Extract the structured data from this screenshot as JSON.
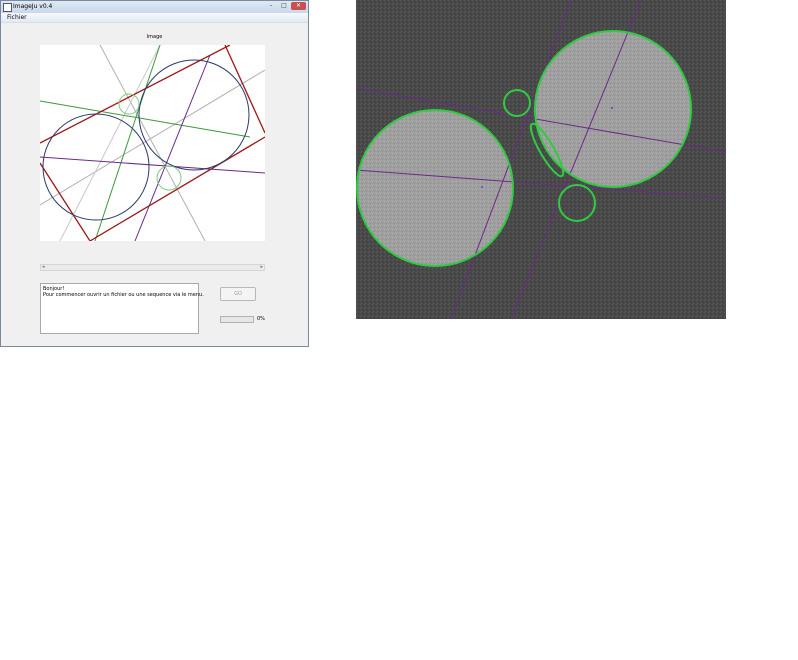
{
  "window": {
    "title": "ImageJu v0.4",
    "menu": [
      "Fichier"
    ],
    "controls": {
      "minimize": "–",
      "maximize": "□",
      "close": "✕"
    }
  },
  "image_panel": {
    "label": "Image"
  },
  "scrollbar": {
    "left_arrow": "◂",
    "right_arrow": "▸"
  },
  "log": {
    "lines": [
      "Bonjour!",
      "Pour commencer ouvrir un fichier ou une sequence via le menu."
    ]
  },
  "go_button": {
    "label": "GO"
  },
  "progress": {
    "value": 0,
    "text": "0%",
    "fill_color": "#2fb52f"
  },
  "colors": {
    "circle_navy": "#2b3a67",
    "line_red": "#a01818",
    "line_green": "#3a9a3a",
    "line_purple": "#6b2a8a",
    "circle_green": "#2ecc40",
    "photo_bg": "#4a4a4a",
    "disk_fill": "#9e9e9e"
  }
}
